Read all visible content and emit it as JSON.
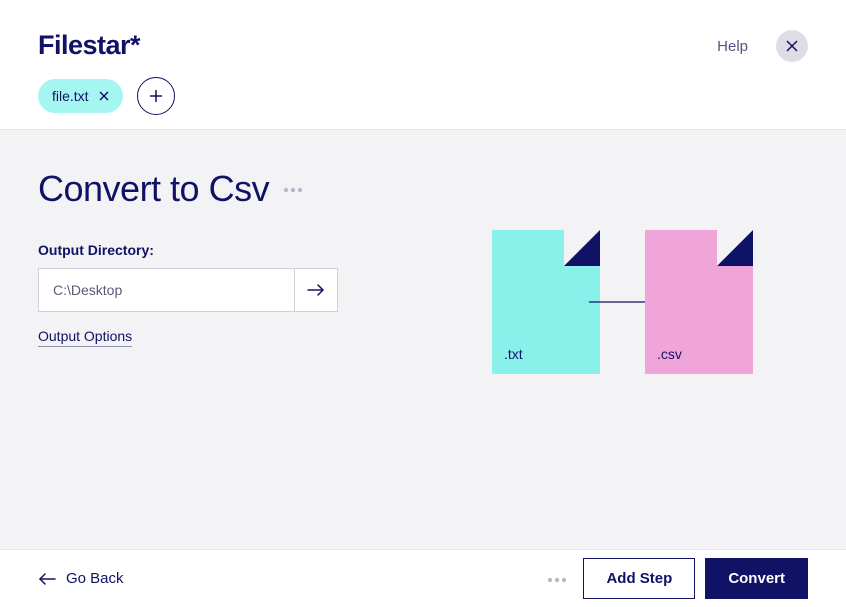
{
  "header": {
    "brand": "Filestar*",
    "help_label": "Help"
  },
  "file_chip": {
    "filename": "file.txt"
  },
  "main": {
    "title": "Convert to Csv",
    "output_directory_label": "Output Directory:",
    "output_directory_value": "C:\\Desktop",
    "output_options_label": "Output Options"
  },
  "illustration": {
    "source_ext": ".txt",
    "target_ext": ".csv"
  },
  "footer": {
    "go_back_label": "Go Back",
    "add_step_label": "Add Step",
    "convert_label": "Convert"
  }
}
